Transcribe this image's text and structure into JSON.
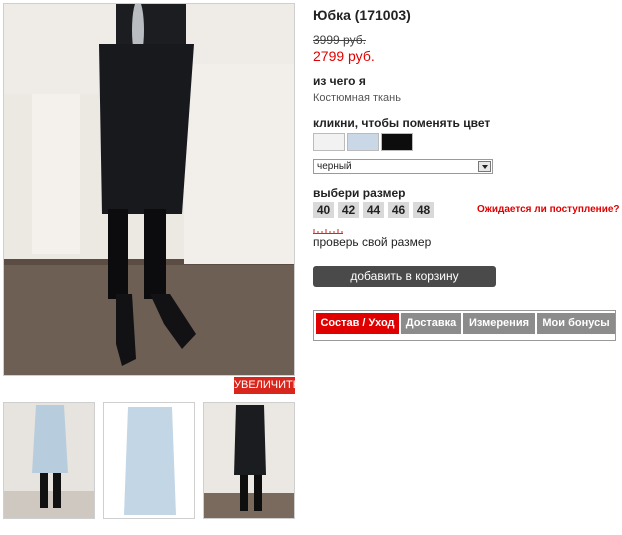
{
  "product": {
    "title": "Юбка (171003)",
    "old_price": "3999 руб.",
    "new_price": "2799 руб."
  },
  "material": {
    "heading": "из чего я",
    "value": "Костюмная ткань"
  },
  "color": {
    "heading": "кликни, чтобы поменять цвет",
    "swatches": [
      {
        "name": "белый",
        "hex": "#f2f2f2"
      },
      {
        "name": "голубой",
        "hex": "#c9d7e6"
      },
      {
        "name": "черный",
        "hex": "#0d0d0d"
      }
    ],
    "selected": "черный"
  },
  "size": {
    "heading": "выбери размер",
    "options": [
      "40",
      "42",
      "44",
      "46",
      "48"
    ],
    "await_link": "Ожидается ли поступление?",
    "check_link": "проверь свой размер"
  },
  "actions": {
    "zoom": "УВЕЛИЧИТЬ",
    "add_to_cart": "добавить в корзину"
  },
  "tabs": [
    "Состав / Уход",
    "Доставка",
    "Измерения",
    "Мои бонусы"
  ],
  "colors": {
    "accent_red": "#e00000",
    "tab_gray": "#8c8c8c",
    "button_dark": "#4a4a4a"
  }
}
